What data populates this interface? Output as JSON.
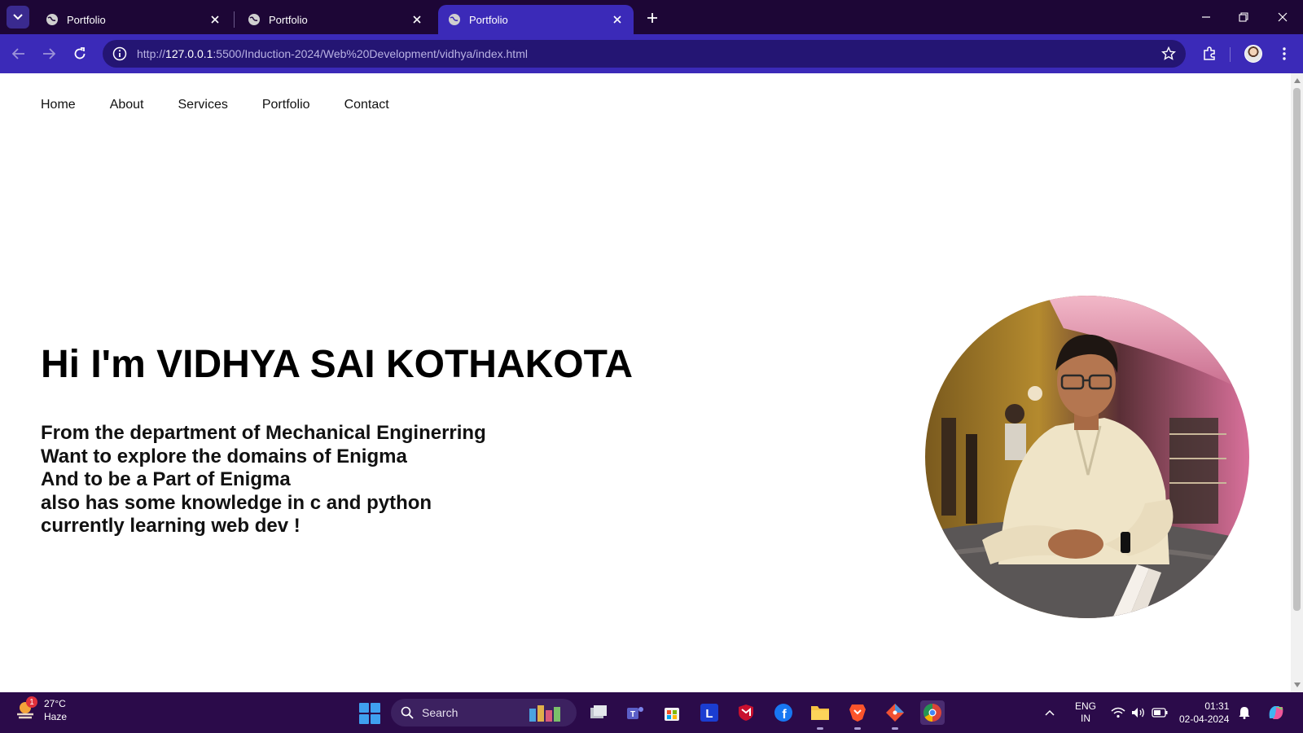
{
  "browser": {
    "tabs": [
      {
        "title": "Portfolio",
        "active": false
      },
      {
        "title": "Portfolio",
        "active": false
      },
      {
        "title": "Portfolio",
        "active": true
      }
    ],
    "url_prefix": "http://",
    "url_host": "127.0.0.1",
    "url_rest": ":5500/Induction-2024/Web%20Development/vidhya/index.html"
  },
  "site": {
    "nav": [
      {
        "label": "Home"
      },
      {
        "label": "About"
      },
      {
        "label": "Services"
      },
      {
        "label": "Portfolio"
      },
      {
        "label": "Contact"
      }
    ],
    "hero": {
      "title": "Hi I'm VIDHYA SAI KOTHAKOTA",
      "lines": [
        "From the department of Mechanical Enginerring",
        "Want to explore the domains of Enigma",
        "And to be a Part of Enigma",
        "also has some knowledge in c and python",
        "currently learning web dev !"
      ]
    }
  },
  "taskbar": {
    "weather": {
      "temp": "27°C",
      "condition": "Haze",
      "badge": "1"
    },
    "search_label": "Search",
    "lang_top": "ENG",
    "lang_bottom": "IN",
    "time": "01:31",
    "date": "02-04-2024"
  },
  "colors": {
    "tabstrip": "#1d0636",
    "toolbar": "#3b2ab8",
    "taskbar": "#2b0b4a"
  }
}
